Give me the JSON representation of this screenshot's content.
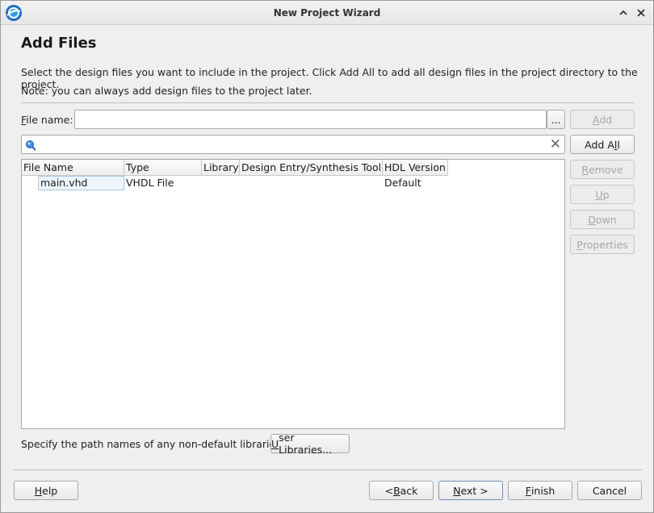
{
  "window": {
    "title": "New Project Wizard",
    "icon": "app-logo-icon",
    "controls": {
      "collapse": "chevron-up-icon",
      "close": "close-icon"
    }
  },
  "page": {
    "title": "Add Files",
    "desc1": "Select the design files you want to include in the project. Click Add All to add all design files in the project directory to the project.",
    "desc2": "Note: you can always add design files to the project later."
  },
  "file_name": {
    "label_mnemonic": "F",
    "label_rest": "ile name:",
    "value": "",
    "browse_label": "..."
  },
  "search": {
    "value": "",
    "icon": "search-icon",
    "clear_icon": "clear-x-icon"
  },
  "table": {
    "columns": [
      "File Name",
      "Type",
      "Library",
      "Design Entry/Synthesis Tool",
      "HDL Version"
    ],
    "rows": [
      {
        "file_name": "main.vhd",
        "type": "VHDL File",
        "library": "",
        "tool": "",
        "hdl_version": "Default"
      }
    ]
  },
  "side_buttons": {
    "add": {
      "m": "A",
      "rest": "dd",
      "enabled": false
    },
    "add_all": {
      "pre": "Add A",
      "m": "l",
      "rest": "l",
      "enabled": true
    },
    "remove": {
      "m": "R",
      "rest": "emove",
      "enabled": false
    },
    "up": {
      "m": "U",
      "rest": "p",
      "enabled": false
    },
    "down": {
      "m": "D",
      "rest": "own",
      "enabled": false
    },
    "properties": {
      "m": "P",
      "rest": "roperties",
      "enabled": false
    }
  },
  "libraries": {
    "text": "Specify the path names of any non-default libraries.",
    "btn_pre": "",
    "btn_m": "U",
    "btn_rest": "ser Libraries..."
  },
  "footer": {
    "help": {
      "m": "H",
      "rest": "elp"
    },
    "back": {
      "pre": "< ",
      "m": "B",
      "rest": "ack"
    },
    "next": {
      "m": "N",
      "rest": "ext >"
    },
    "finish": {
      "m": "F",
      "rest": "inish"
    },
    "cancel": "Cancel"
  },
  "colors": {
    "accent": "#2a7fd4",
    "selection_border": "#a7c7e6"
  }
}
